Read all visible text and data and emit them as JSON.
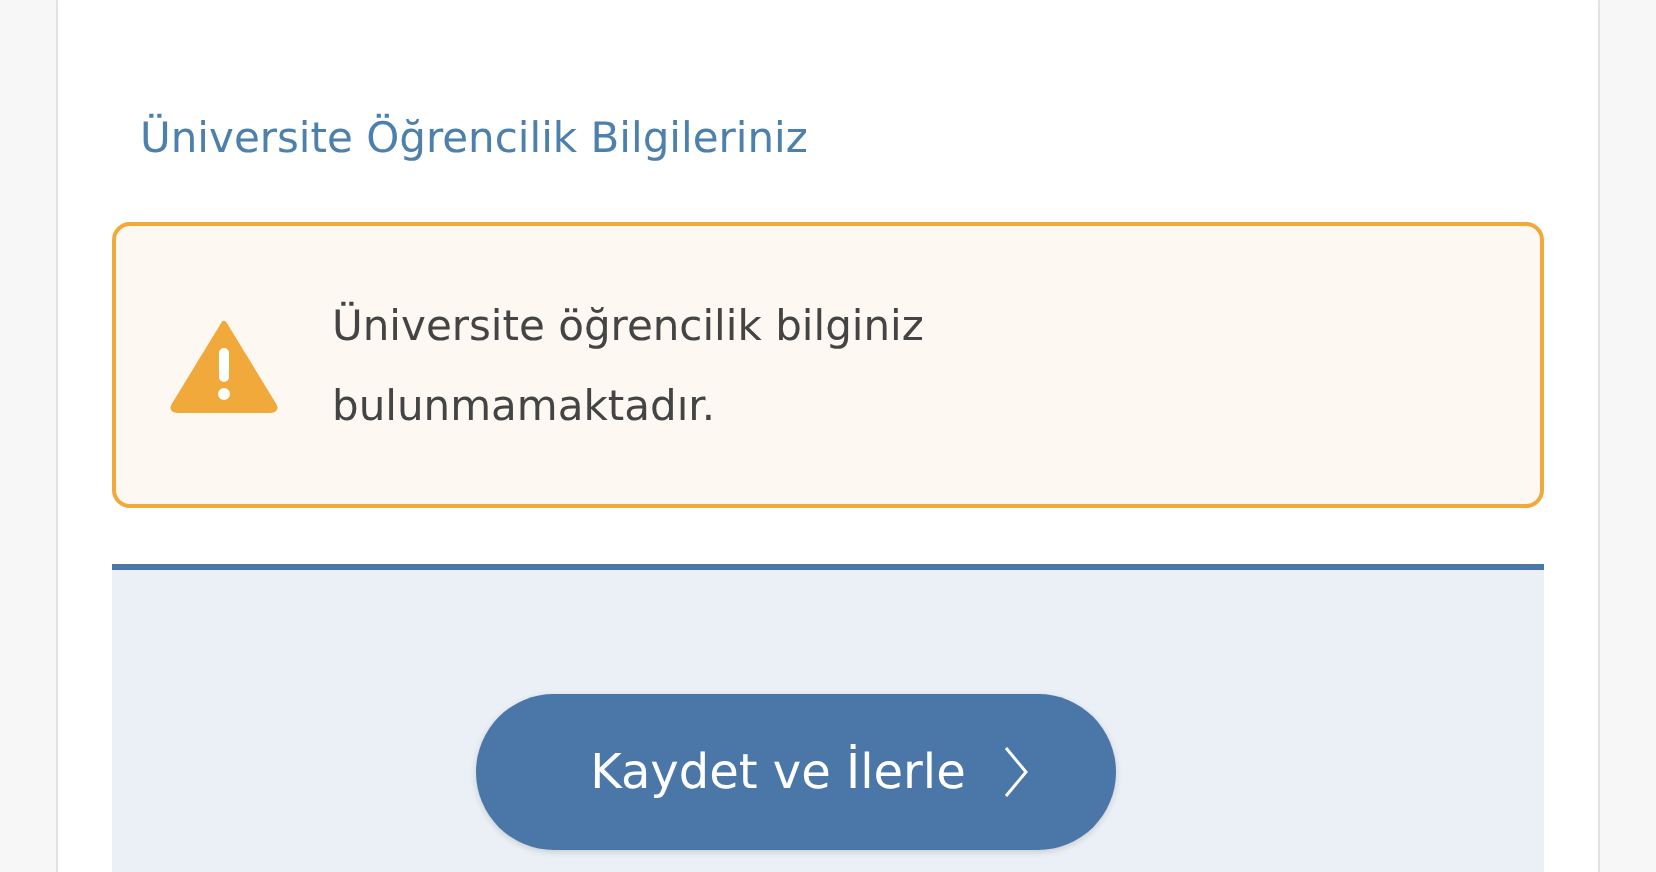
{
  "section": {
    "title": "Üniversite Öğrencilik Bilgileriniz"
  },
  "alert": {
    "kind": "warning",
    "message": "Üniversite öğrencilik bilginiz bulunmamaktadır."
  },
  "footer": {
    "button": {
      "label": "Kaydet ve İlerle"
    }
  }
}
